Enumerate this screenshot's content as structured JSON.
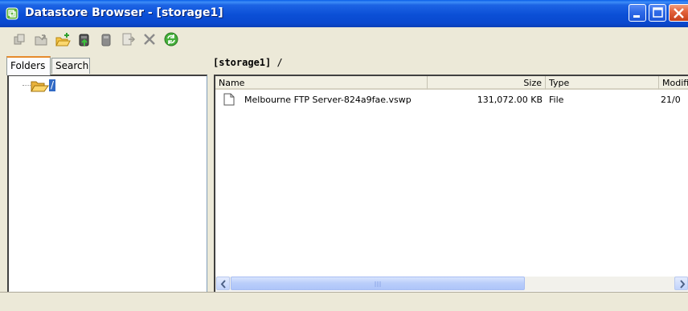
{
  "window": {
    "title": "Datastore Browser - [storage1]",
    "accent_color": "#0a4fd6",
    "close_color": "#d95a2a"
  },
  "toolbar": {
    "buttons": [
      {
        "icon": "back-icon"
      },
      {
        "icon": "up-folder-icon"
      },
      {
        "icon": "new-folder-icon"
      },
      {
        "icon": "upload-icon"
      },
      {
        "icon": "download-icon"
      },
      {
        "icon": "move-icon"
      },
      {
        "icon": "delete-icon"
      },
      {
        "icon": "refresh-icon"
      }
    ]
  },
  "tabs": [
    {
      "label": "Folders",
      "active": true
    },
    {
      "label": "Search",
      "active": false
    }
  ],
  "path": {
    "datastore": "[storage1]",
    "folder": "/"
  },
  "folder_tree": {
    "root_label": "/"
  },
  "file_list": {
    "columns": [
      "Name",
      "Size",
      "Type",
      "Modifi"
    ],
    "rows": [
      {
        "name": "Melbourne FTP Server-824a9fae.vswp",
        "size": "131,072.00 KB",
        "type": "File",
        "modified": "21/0"
      }
    ]
  }
}
